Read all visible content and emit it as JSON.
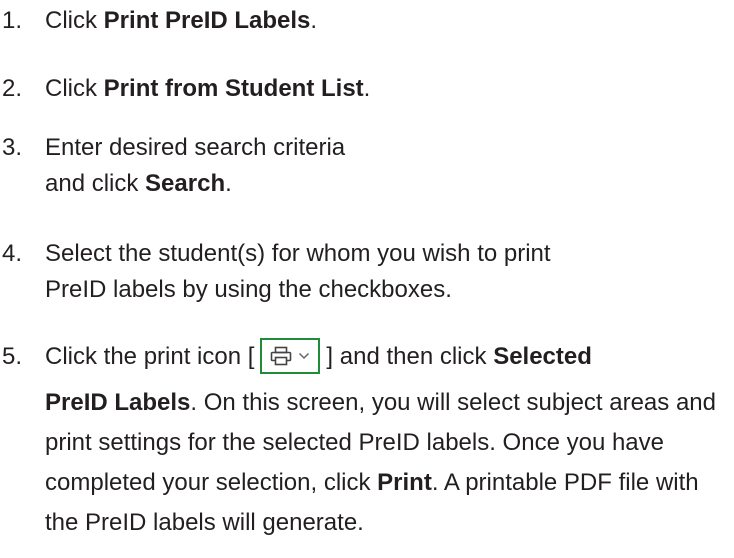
{
  "steps": [
    {
      "number": "1.",
      "pre": "Click ",
      "bold": "Print PreID Labels",
      "post": "."
    },
    {
      "number": "2.",
      "pre": "Click ",
      "bold": "Print from Student List",
      "post": "."
    },
    {
      "number": "3.",
      "line1": "Enter desired search criteria",
      "pre": "and click ",
      "bold": "Search",
      "post": "."
    },
    {
      "number": "4.",
      "line1": "Select the student(s) for whom you wish to print",
      "line2": "PreID labels by using the checkboxes."
    },
    {
      "number": "5.",
      "pre": "Click the print icon [",
      "mid": "] and then click ",
      "bold1": "Selected",
      "bold2": "PreID Labels",
      "text2": ". On this screen, you will select subject areas and print settings for the selected PreID labels. Once you have completed your selection, click ",
      "bold3": "Print",
      "text3": ". A printable PDF file with the PreID labels will generate."
    }
  ],
  "icons": {
    "print": "printer-icon",
    "dropdown": "chevron-down-icon",
    "button_border_color": "#1e8c3a"
  }
}
